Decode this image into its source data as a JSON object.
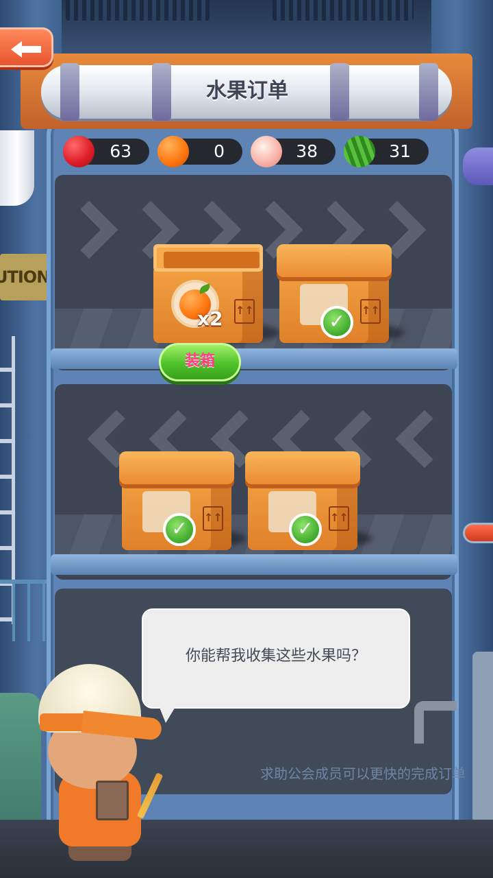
{
  "header": {
    "title": "水果订单",
    "back_icon": "back-arrow-icon"
  },
  "resources": [
    {
      "name": "strawberry",
      "icon": "strawberry-icon",
      "count": "63",
      "color": "#e0202a"
    },
    {
      "name": "orange",
      "icon": "orange-icon",
      "count": "0",
      "color": "#ff7a12"
    },
    {
      "name": "peach",
      "icon": "peach-icon",
      "count": "38",
      "color": "#f7b0a5"
    },
    {
      "name": "watermelon",
      "icon": "watermelon-icon",
      "count": "31",
      "color": "#3aa32a"
    }
  ],
  "orders": [
    {
      "state": "open",
      "fruit": "orange-icon",
      "quantity": "x2",
      "action_label": "装箱"
    },
    {
      "state": "completed",
      "icon": "check-icon"
    },
    {
      "state": "completed",
      "icon": "check-icon"
    },
    {
      "state": "completed",
      "icon": "check-icon"
    }
  ],
  "dialog": {
    "text": "你能帮我收集这些水果吗？"
  },
  "hint": {
    "text": "求助公会成员可以更快的完成订单"
  },
  "signs": {
    "caution": "UTION"
  },
  "colors": {
    "accent": "#e8542f",
    "action_button": "#4fc12b",
    "action_text": "#ff3f86",
    "panel": "#5d84b5"
  }
}
